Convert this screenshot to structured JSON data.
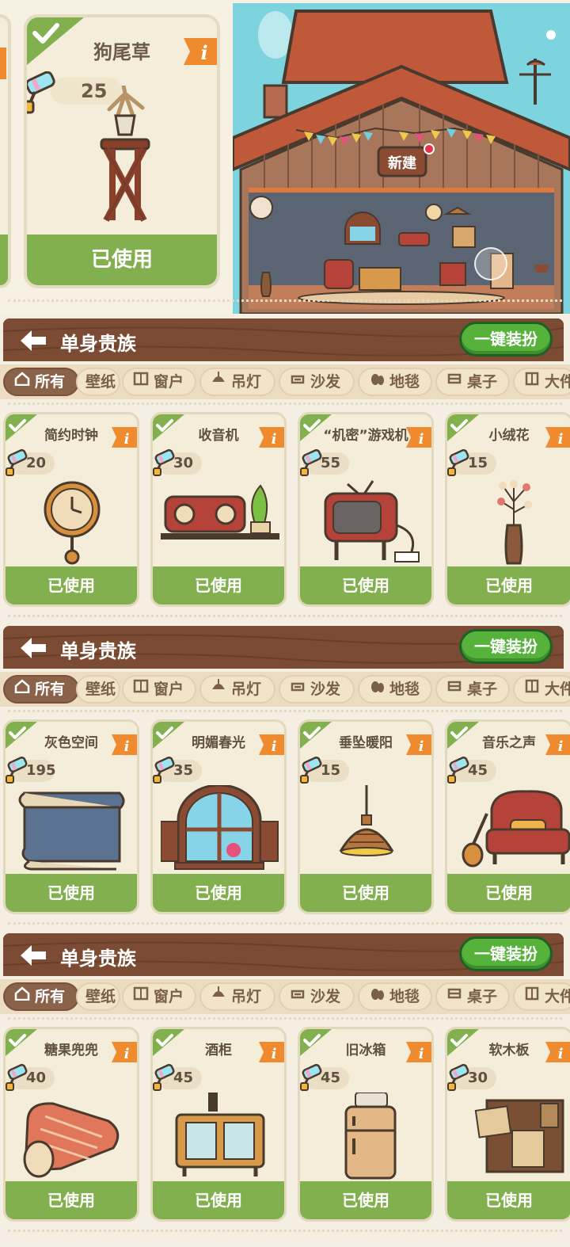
{
  "top": {
    "card": {
      "title": "狗尾草",
      "price": "25",
      "status": "已使用"
    },
    "scene": {
      "sign": "新建"
    }
  },
  "panels": [
    {
      "header": {
        "title": "单身贵族",
        "onekey": "一键装扮"
      },
      "tabs": [
        "所有",
        "壁纸",
        "窗户",
        "吊灯",
        "沙发",
        "地毯",
        "桌子",
        "大件"
      ],
      "cards": [
        {
          "title": "简约时钟",
          "price": "20",
          "status": "已使用",
          "icon": "clock"
        },
        {
          "title": "收音机",
          "price": "30",
          "status": "已使用",
          "icon": "radio"
        },
        {
          "title": "“机密”游戏机",
          "price": "55",
          "status": "已使用",
          "icon": "tv"
        },
        {
          "title": "小绒花",
          "price": "15",
          "status": "已使用",
          "icon": "vase"
        }
      ]
    },
    {
      "header": {
        "title": "单身贵族",
        "onekey": "一键装扮"
      },
      "tabs": [
        "所有",
        "壁纸",
        "窗户",
        "吊灯",
        "沙发",
        "地毯",
        "桌子",
        "大件"
      ],
      "cards": [
        {
          "title": "灰色空间",
          "price": "195",
          "status": "已使用",
          "icon": "wallpaper"
        },
        {
          "title": "明媚春光",
          "price": "35",
          "status": "已使用",
          "icon": "window"
        },
        {
          "title": "垂坠暖阳",
          "price": "15",
          "status": "已使用",
          "icon": "lamp"
        },
        {
          "title": "音乐之声",
          "price": "45",
          "status": "已使用",
          "icon": "sofa"
        }
      ]
    },
    {
      "header": {
        "title": "单身贵族",
        "onekey": "一键装扮"
      },
      "tabs": [
        "所有",
        "壁纸",
        "窗户",
        "吊灯",
        "沙发",
        "地毯",
        "桌子",
        "大件"
      ],
      "cards": [
        {
          "title": "糖果兜兜",
          "price": "40",
          "status": "已使用",
          "icon": "rug"
        },
        {
          "title": "酒柜",
          "price": "45",
          "status": "已使用",
          "icon": "cabinet"
        },
        {
          "title": "旧冰箱",
          "price": "45",
          "status": "已使用",
          "icon": "fridge"
        },
        {
          "title": "软木板",
          "price": "30",
          "status": "已使用",
          "icon": "corkboard"
        }
      ]
    }
  ],
  "colors": {
    "green": "#83b04e",
    "header_brown": "#7b4c33",
    "accent_orange": "#ef8a2e"
  }
}
